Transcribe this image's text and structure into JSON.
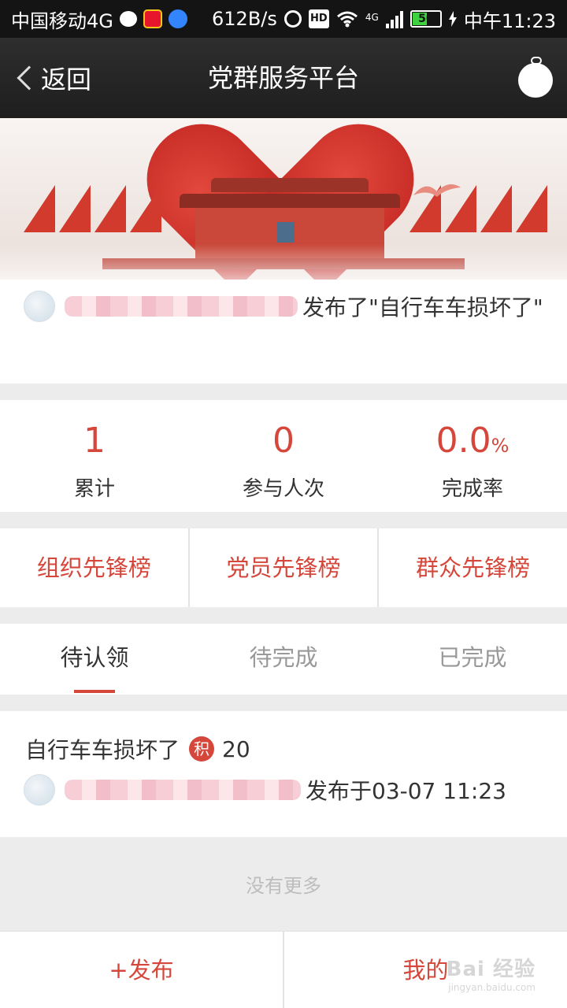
{
  "status_bar": {
    "carrier": "中国移动4G",
    "net_speed": "612B/s",
    "hd": "HD",
    "network_type": "4G",
    "battery": "50",
    "time": "中午11:23",
    "icons": [
      "wechat-icon",
      "weibo-icon",
      "tieba-icon",
      "alarm-icon",
      "hd-icon",
      "wifi-icon",
      "signal-icon",
      "battery-icon",
      "charging-icon"
    ]
  },
  "nav": {
    "back_label": "返回",
    "title": "党群服务平台"
  },
  "announcement": {
    "text": "发布了\"自行车车损坏了\""
  },
  "stats": [
    {
      "value": "1",
      "unit": "",
      "label": "累计"
    },
    {
      "value": "0",
      "unit": "",
      "label": "参与人次"
    },
    {
      "value": "0.0",
      "unit": "%",
      "label": "完成率"
    }
  ],
  "boards": [
    {
      "label": "组织先锋榜"
    },
    {
      "label": "党员先锋榜"
    },
    {
      "label": "群众先锋榜"
    }
  ],
  "tabs": [
    {
      "label": "待认领",
      "active": true
    },
    {
      "label": "待完成",
      "active": false
    },
    {
      "label": "已完成",
      "active": false
    }
  ],
  "task": {
    "title": "自行车车损坏了",
    "points_badge": "积",
    "points": "20",
    "published": "发布于03-07 11:23"
  },
  "list_footer": "没有更多",
  "bottom_bar": {
    "publish_label": "+发布",
    "mine_label": "我的"
  },
  "colors": {
    "accent": "#d5473a",
    "nav_bg": "#262626",
    "page_bg": "#ececec"
  }
}
